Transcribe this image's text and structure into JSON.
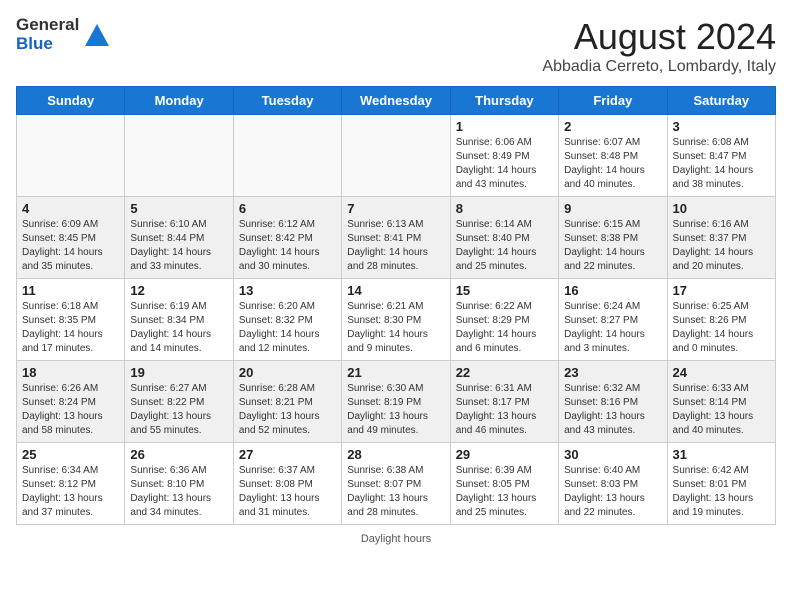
{
  "header": {
    "logo_general": "General",
    "logo_blue": "Blue",
    "month": "August 2024",
    "location": "Abbadia Cerreto, Lombardy, Italy"
  },
  "days_of_week": [
    "Sunday",
    "Monday",
    "Tuesday",
    "Wednesday",
    "Thursday",
    "Friday",
    "Saturday"
  ],
  "weeks": [
    [
      {
        "date": "",
        "info": ""
      },
      {
        "date": "",
        "info": ""
      },
      {
        "date": "",
        "info": ""
      },
      {
        "date": "",
        "info": ""
      },
      {
        "date": "1",
        "info": "Sunrise: 6:06 AM\nSunset: 8:49 PM\nDaylight: 14 hours and 43 minutes."
      },
      {
        "date": "2",
        "info": "Sunrise: 6:07 AM\nSunset: 8:48 PM\nDaylight: 14 hours and 40 minutes."
      },
      {
        "date": "3",
        "info": "Sunrise: 6:08 AM\nSunset: 8:47 PM\nDaylight: 14 hours and 38 minutes."
      }
    ],
    [
      {
        "date": "4",
        "info": "Sunrise: 6:09 AM\nSunset: 8:45 PM\nDaylight: 14 hours and 35 minutes."
      },
      {
        "date": "5",
        "info": "Sunrise: 6:10 AM\nSunset: 8:44 PM\nDaylight: 14 hours and 33 minutes."
      },
      {
        "date": "6",
        "info": "Sunrise: 6:12 AM\nSunset: 8:42 PM\nDaylight: 14 hours and 30 minutes."
      },
      {
        "date": "7",
        "info": "Sunrise: 6:13 AM\nSunset: 8:41 PM\nDaylight: 14 hours and 28 minutes."
      },
      {
        "date": "8",
        "info": "Sunrise: 6:14 AM\nSunset: 8:40 PM\nDaylight: 14 hours and 25 minutes."
      },
      {
        "date": "9",
        "info": "Sunrise: 6:15 AM\nSunset: 8:38 PM\nDaylight: 14 hours and 22 minutes."
      },
      {
        "date": "10",
        "info": "Sunrise: 6:16 AM\nSunset: 8:37 PM\nDaylight: 14 hours and 20 minutes."
      }
    ],
    [
      {
        "date": "11",
        "info": "Sunrise: 6:18 AM\nSunset: 8:35 PM\nDaylight: 14 hours and 17 minutes."
      },
      {
        "date": "12",
        "info": "Sunrise: 6:19 AM\nSunset: 8:34 PM\nDaylight: 14 hours and 14 minutes."
      },
      {
        "date": "13",
        "info": "Sunrise: 6:20 AM\nSunset: 8:32 PM\nDaylight: 14 hours and 12 minutes."
      },
      {
        "date": "14",
        "info": "Sunrise: 6:21 AM\nSunset: 8:30 PM\nDaylight: 14 hours and 9 minutes."
      },
      {
        "date": "15",
        "info": "Sunrise: 6:22 AM\nSunset: 8:29 PM\nDaylight: 14 hours and 6 minutes."
      },
      {
        "date": "16",
        "info": "Sunrise: 6:24 AM\nSunset: 8:27 PM\nDaylight: 14 hours and 3 minutes."
      },
      {
        "date": "17",
        "info": "Sunrise: 6:25 AM\nSunset: 8:26 PM\nDaylight: 14 hours and 0 minutes."
      }
    ],
    [
      {
        "date": "18",
        "info": "Sunrise: 6:26 AM\nSunset: 8:24 PM\nDaylight: 13 hours and 58 minutes."
      },
      {
        "date": "19",
        "info": "Sunrise: 6:27 AM\nSunset: 8:22 PM\nDaylight: 13 hours and 55 minutes."
      },
      {
        "date": "20",
        "info": "Sunrise: 6:28 AM\nSunset: 8:21 PM\nDaylight: 13 hours and 52 minutes."
      },
      {
        "date": "21",
        "info": "Sunrise: 6:30 AM\nSunset: 8:19 PM\nDaylight: 13 hours and 49 minutes."
      },
      {
        "date": "22",
        "info": "Sunrise: 6:31 AM\nSunset: 8:17 PM\nDaylight: 13 hours and 46 minutes."
      },
      {
        "date": "23",
        "info": "Sunrise: 6:32 AM\nSunset: 8:16 PM\nDaylight: 13 hours and 43 minutes."
      },
      {
        "date": "24",
        "info": "Sunrise: 6:33 AM\nSunset: 8:14 PM\nDaylight: 13 hours and 40 minutes."
      }
    ],
    [
      {
        "date": "25",
        "info": "Sunrise: 6:34 AM\nSunset: 8:12 PM\nDaylight: 13 hours and 37 minutes."
      },
      {
        "date": "26",
        "info": "Sunrise: 6:36 AM\nSunset: 8:10 PM\nDaylight: 13 hours and 34 minutes."
      },
      {
        "date": "27",
        "info": "Sunrise: 6:37 AM\nSunset: 8:08 PM\nDaylight: 13 hours and 31 minutes."
      },
      {
        "date": "28",
        "info": "Sunrise: 6:38 AM\nSunset: 8:07 PM\nDaylight: 13 hours and 28 minutes."
      },
      {
        "date": "29",
        "info": "Sunrise: 6:39 AM\nSunset: 8:05 PM\nDaylight: 13 hours and 25 minutes."
      },
      {
        "date": "30",
        "info": "Sunrise: 6:40 AM\nSunset: 8:03 PM\nDaylight: 13 hours and 22 minutes."
      },
      {
        "date": "31",
        "info": "Sunrise: 6:42 AM\nSunset: 8:01 PM\nDaylight: 13 hours and 19 minutes."
      }
    ]
  ],
  "footer": "Daylight hours"
}
